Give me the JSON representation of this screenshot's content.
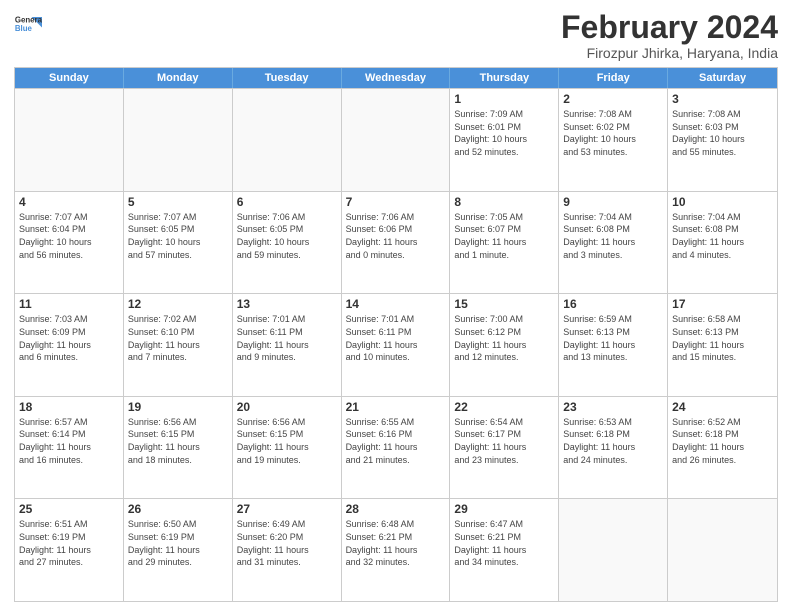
{
  "header": {
    "logo_line1": "General",
    "logo_line2": "Blue",
    "month_title": "February 2024",
    "location": "Firozpur Jhirka, Haryana, India"
  },
  "days_of_week": [
    "Sunday",
    "Monday",
    "Tuesday",
    "Wednesday",
    "Thursday",
    "Friday",
    "Saturday"
  ],
  "weeks": [
    [
      {
        "day": "",
        "info": "",
        "empty": true
      },
      {
        "day": "",
        "info": "",
        "empty": true
      },
      {
        "day": "",
        "info": "",
        "empty": true
      },
      {
        "day": "",
        "info": "",
        "empty": true
      },
      {
        "day": "1",
        "info": "Sunrise: 7:09 AM\nSunset: 6:01 PM\nDaylight: 10 hours\nand 52 minutes.",
        "empty": false
      },
      {
        "day": "2",
        "info": "Sunrise: 7:08 AM\nSunset: 6:02 PM\nDaylight: 10 hours\nand 53 minutes.",
        "empty": false
      },
      {
        "day": "3",
        "info": "Sunrise: 7:08 AM\nSunset: 6:03 PM\nDaylight: 10 hours\nand 55 minutes.",
        "empty": false
      }
    ],
    [
      {
        "day": "4",
        "info": "Sunrise: 7:07 AM\nSunset: 6:04 PM\nDaylight: 10 hours\nand 56 minutes.",
        "empty": false
      },
      {
        "day": "5",
        "info": "Sunrise: 7:07 AM\nSunset: 6:05 PM\nDaylight: 10 hours\nand 57 minutes.",
        "empty": false
      },
      {
        "day": "6",
        "info": "Sunrise: 7:06 AM\nSunset: 6:05 PM\nDaylight: 10 hours\nand 59 minutes.",
        "empty": false
      },
      {
        "day": "7",
        "info": "Sunrise: 7:06 AM\nSunset: 6:06 PM\nDaylight: 11 hours\nand 0 minutes.",
        "empty": false
      },
      {
        "day": "8",
        "info": "Sunrise: 7:05 AM\nSunset: 6:07 PM\nDaylight: 11 hours\nand 1 minute.",
        "empty": false
      },
      {
        "day": "9",
        "info": "Sunrise: 7:04 AM\nSunset: 6:08 PM\nDaylight: 11 hours\nand 3 minutes.",
        "empty": false
      },
      {
        "day": "10",
        "info": "Sunrise: 7:04 AM\nSunset: 6:08 PM\nDaylight: 11 hours\nand 4 minutes.",
        "empty": false
      }
    ],
    [
      {
        "day": "11",
        "info": "Sunrise: 7:03 AM\nSunset: 6:09 PM\nDaylight: 11 hours\nand 6 minutes.",
        "empty": false
      },
      {
        "day": "12",
        "info": "Sunrise: 7:02 AM\nSunset: 6:10 PM\nDaylight: 11 hours\nand 7 minutes.",
        "empty": false
      },
      {
        "day": "13",
        "info": "Sunrise: 7:01 AM\nSunset: 6:11 PM\nDaylight: 11 hours\nand 9 minutes.",
        "empty": false
      },
      {
        "day": "14",
        "info": "Sunrise: 7:01 AM\nSunset: 6:11 PM\nDaylight: 11 hours\nand 10 minutes.",
        "empty": false
      },
      {
        "day": "15",
        "info": "Sunrise: 7:00 AM\nSunset: 6:12 PM\nDaylight: 11 hours\nand 12 minutes.",
        "empty": false
      },
      {
        "day": "16",
        "info": "Sunrise: 6:59 AM\nSunset: 6:13 PM\nDaylight: 11 hours\nand 13 minutes.",
        "empty": false
      },
      {
        "day": "17",
        "info": "Sunrise: 6:58 AM\nSunset: 6:13 PM\nDaylight: 11 hours\nand 15 minutes.",
        "empty": false
      }
    ],
    [
      {
        "day": "18",
        "info": "Sunrise: 6:57 AM\nSunset: 6:14 PM\nDaylight: 11 hours\nand 16 minutes.",
        "empty": false
      },
      {
        "day": "19",
        "info": "Sunrise: 6:56 AM\nSunset: 6:15 PM\nDaylight: 11 hours\nand 18 minutes.",
        "empty": false
      },
      {
        "day": "20",
        "info": "Sunrise: 6:56 AM\nSunset: 6:15 PM\nDaylight: 11 hours\nand 19 minutes.",
        "empty": false
      },
      {
        "day": "21",
        "info": "Sunrise: 6:55 AM\nSunset: 6:16 PM\nDaylight: 11 hours\nand 21 minutes.",
        "empty": false
      },
      {
        "day": "22",
        "info": "Sunrise: 6:54 AM\nSunset: 6:17 PM\nDaylight: 11 hours\nand 23 minutes.",
        "empty": false
      },
      {
        "day": "23",
        "info": "Sunrise: 6:53 AM\nSunset: 6:18 PM\nDaylight: 11 hours\nand 24 minutes.",
        "empty": false
      },
      {
        "day": "24",
        "info": "Sunrise: 6:52 AM\nSunset: 6:18 PM\nDaylight: 11 hours\nand 26 minutes.",
        "empty": false
      }
    ],
    [
      {
        "day": "25",
        "info": "Sunrise: 6:51 AM\nSunset: 6:19 PM\nDaylight: 11 hours\nand 27 minutes.",
        "empty": false
      },
      {
        "day": "26",
        "info": "Sunrise: 6:50 AM\nSunset: 6:19 PM\nDaylight: 11 hours\nand 29 minutes.",
        "empty": false
      },
      {
        "day": "27",
        "info": "Sunrise: 6:49 AM\nSunset: 6:20 PM\nDaylight: 11 hours\nand 31 minutes.",
        "empty": false
      },
      {
        "day": "28",
        "info": "Sunrise: 6:48 AM\nSunset: 6:21 PM\nDaylight: 11 hours\nand 32 minutes.",
        "empty": false
      },
      {
        "day": "29",
        "info": "Sunrise: 6:47 AM\nSunset: 6:21 PM\nDaylight: 11 hours\nand 34 minutes.",
        "empty": false
      },
      {
        "day": "",
        "info": "",
        "empty": true
      },
      {
        "day": "",
        "info": "",
        "empty": true
      }
    ]
  ]
}
